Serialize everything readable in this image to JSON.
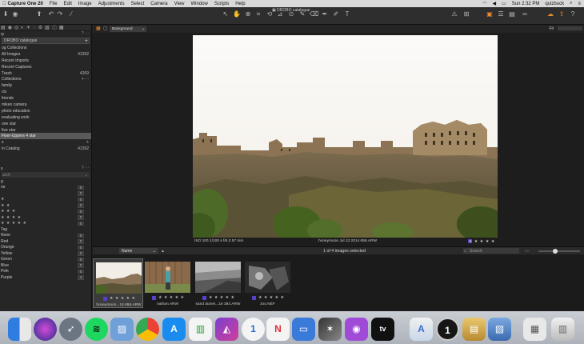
{
  "menubar": {
    "app": "Capture One 20",
    "items": [
      "File",
      "Edit",
      "Image",
      "Adjustments",
      "Select",
      "Camera",
      "View",
      "Window",
      "Scripts",
      "Help"
    ],
    "clock": "Sun 2:32 PM",
    "user": "quizbuck"
  },
  "toolbar": {
    "catalog_title": "DROBO catalogue"
  },
  "library": {
    "title": "ry",
    "catalog_selector": "DROBO catalogue",
    "catalog_collections_header": "og Collections",
    "items": [
      {
        "label": "All Images",
        "count": "41392"
      },
      {
        "label": "Recent Imports",
        "count": ""
      },
      {
        "label": "Recent Captures",
        "count": ""
      },
      {
        "label": "Trash",
        "count": "4269"
      }
    ],
    "user_collections_header": "Collections",
    "collections": [
      "family",
      "cls",
      "friends",
      "mikeo camera",
      "photo education",
      "evaluating work",
      "one star",
      "five star",
      "Fixer-Uppers 4 star"
    ],
    "section3_header": "s",
    "in_catalog": {
      "label": "in Catalog",
      "count": "41392"
    }
  },
  "filters": {
    "header": "s",
    "search_placeholder": "arch",
    "rating_header": "g",
    "ratings": [
      {
        "label": "ne",
        "count": "0"
      },
      {
        "label": "",
        "count": "0"
      },
      {
        "label": "★",
        "count": "0"
      },
      {
        "label": "★ ★",
        "count": "0"
      },
      {
        "label": "★ ★ ★",
        "count": "0"
      },
      {
        "label": "★ ★ ★ ★",
        "count": "0"
      },
      {
        "label": "★ ★ ★ ★ ★",
        "count": "0"
      }
    ],
    "tag_header": "Tag",
    "tags": [
      {
        "label": "None",
        "count": "0"
      },
      {
        "label": "Red",
        "count": "0"
      },
      {
        "label": "Orange",
        "count": "0"
      },
      {
        "label": "Yellow",
        "count": "0"
      },
      {
        "label": "Green",
        "count": "0"
      },
      {
        "label": "Blue",
        "count": "0"
      },
      {
        "label": "Pink",
        "count": "0"
      },
      {
        "label": "Purple",
        "count": "4"
      }
    ]
  },
  "viewer": {
    "background_label": "Background",
    "fit_label": "Fit",
    "meta": "ISO 100    1/100 s    f/6.3    57 mm",
    "filename": "honeymoon Jul 13 2014 655.ARW",
    "rating": "★ ★ ★ ★ ★"
  },
  "browser": {
    "sort_label": "Name",
    "selection_count": "1 of 4 images selected",
    "search_placeholder": "Search",
    "thumbnails": [
      {
        "name": "honeymoon...14 655.ARW",
        "rating": "★ ★ ★ ★ ★"
      },
      {
        "name": "nathan.ARW",
        "rating": "★ ★ ★ ★ ★"
      },
      {
        "name": "sand dunes...16 384.ARW",
        "rating": "★ ★ ★ ★ ★"
      },
      {
        "name": "zoo.NEF",
        "rating": "★ ★ ★ ★ ★"
      }
    ]
  },
  "dock": {
    "items": [
      "Finder",
      "Siri",
      "Launchpad",
      "Spotify",
      "Preview",
      "Chrome",
      "App Store",
      "Numbers",
      "Affinity Photo",
      "1Password",
      "News",
      "Keynote",
      "Final Cut Pro",
      "Podcasts",
      "TV",
      "Applications",
      "Capture One",
      "Documents",
      "Downloads",
      "Stack",
      "Trash"
    ],
    "tv_label": "tv"
  },
  "colors": {
    "accent": "#e8892a",
    "purple_tag": "#5a3fc7",
    "selection": "#5a5a5a"
  }
}
